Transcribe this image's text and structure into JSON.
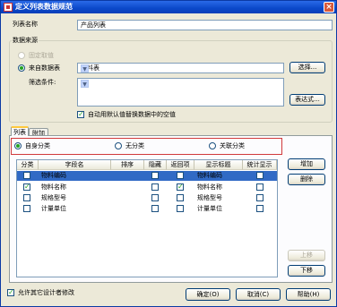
{
  "window": {
    "title": "定义列表数据规范",
    "close_label": "×"
  },
  "list_name": {
    "label": "列表名称",
    "value": "产品列表"
  },
  "data_source": {
    "legend": "数据来源",
    "option_fixed": "固定取值",
    "option_table": "来自数据表",
    "table_value": "物料表",
    "select_button": "选择...",
    "filter_label": "筛选条件:",
    "filter_value": "",
    "expression_button": "表达式...",
    "default_replace_label": "自动用默认值替换数据中的空值"
  },
  "tabs": [
    "列表",
    "附加"
  ],
  "classify": {
    "options": [
      "自身分类",
      "无分类",
      "关联分类"
    ]
  },
  "grid": {
    "headers": [
      "分类",
      "字段名",
      "排序",
      "隐藏",
      "返回项",
      "显示标题",
      "统计显示"
    ],
    "rows": [
      {
        "classify": false,
        "field": "物料编码",
        "sort": "",
        "hidden": false,
        "returned": false,
        "title": "物料编码",
        "stat": false
      },
      {
        "classify": true,
        "field": "物料名称",
        "sort": "",
        "hidden": false,
        "returned": true,
        "title": "物料名称",
        "stat": false
      },
      {
        "classify": false,
        "field": "规格型号",
        "sort": "",
        "hidden": false,
        "returned": false,
        "title": "规格型号",
        "stat": false
      },
      {
        "classify": false,
        "field": "计量单位",
        "sort": "",
        "hidden": false,
        "returned": false,
        "title": "计量单位",
        "stat": false
      }
    ]
  },
  "side_buttons": {
    "add": "增加",
    "delete": "删除",
    "up": "上移",
    "down": "下移"
  },
  "allow_other_edit": "允许其它设计者修改",
  "footer": {
    "ok": "确定(O)",
    "cancel": "取消(C)",
    "help": "帮助(H)"
  }
}
